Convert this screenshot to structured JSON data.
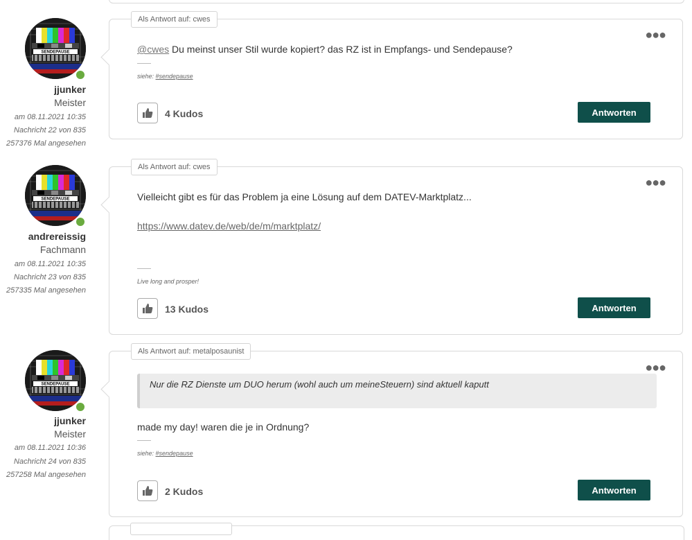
{
  "posts": [
    {
      "reply_tag": "Als Antwort auf: cwes",
      "author": {
        "name": "jjunker",
        "rank": "Meister",
        "date": "am 08.11.2021 10:35",
        "message_no": "Nachricht 22 von 835",
        "views": "257376 Mal angesehen",
        "avatar_label": "SENDEPAUSE"
      },
      "mention": "@cwes",
      "text": " Du meinst unser Stil wurde kopiert? das RZ ist in Empfangs- und Sendepause?",
      "signature_prefix": "siehe: ",
      "signature_link": "#sendepause",
      "kudos": "4 Kudos",
      "answer_label": "Antworten",
      "menu_icon": "ellipsis-icon"
    },
    {
      "reply_tag": "Als Antwort auf: cwes",
      "author": {
        "name": "andrereissig",
        "rank": "Fachmann",
        "date": "am 08.11.2021 10:35",
        "message_no": "Nachricht 23 von 835",
        "views": "257335 Mal angesehen",
        "avatar_label": "SENDEPAUSE"
      },
      "text": "Vielleicht gibt es für das Problem ja eine Lösung auf dem DATEV-Marktplatz...",
      "link": "https://www.datev.de/web/de/m/marktplatz/",
      "signature": "Live long and prosper!",
      "kudos": "13 Kudos",
      "answer_label": "Antworten",
      "menu_icon": "ellipsis-icon"
    },
    {
      "reply_tag": "Als Antwort auf: metalposaunist",
      "author": {
        "name": "jjunker",
        "rank": "Meister",
        "date": "am 08.11.2021 10:36",
        "message_no": "Nachricht 24 von 835",
        "views": "257258 Mal angesehen",
        "avatar_label": "SENDEPAUSE"
      },
      "quote": "Nur die RZ Dienste um DUO herum (wohl auch um meineSteuern) sind aktuell kaputt",
      "text": "made my day! waren die je in Ordnung?",
      "signature_prefix": "siehe: ",
      "signature_link": "#sendepause",
      "kudos": "2 Kudos",
      "answer_label": "Antworten",
      "menu_icon": "ellipsis-icon"
    }
  ],
  "colors": {
    "accent": "#0f4f4a",
    "online": "#6aab3f",
    "border": "#d9d9d9"
  }
}
